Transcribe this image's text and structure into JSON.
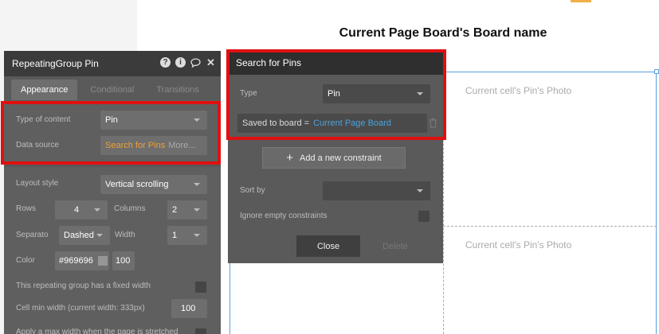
{
  "canvas": {
    "page_title": "Current Page Board's Board name",
    "cell_photo_1": "Current cell's Pin's Photo",
    "cell_photo_2": "Current cell's Pin's Photo"
  },
  "property_editor": {
    "title": "RepeatingGroup Pin",
    "header_icons": [
      "help-icon",
      "info-icon",
      "comment-icon",
      "close-icon"
    ],
    "tabs": [
      "Appearance",
      "Conditional",
      "Transitions"
    ],
    "active_tab": "Appearance",
    "type_of_content": {
      "label": "Type of content",
      "value": "Pin"
    },
    "data_source": {
      "label": "Data source",
      "value": "Search for Pins",
      "more": "More..."
    },
    "layout_style": {
      "label": "Layout style",
      "value": "Vertical scrolling"
    },
    "rows": {
      "label": "Rows",
      "value": "4"
    },
    "columns": {
      "label": "Columns",
      "value": "2"
    },
    "separator": {
      "label": "Separato",
      "value": "Dashed"
    },
    "width": {
      "label": "Width",
      "value": "1"
    },
    "color": {
      "label": "Color",
      "hex": "#969696",
      "opacity": "100"
    },
    "fixed_width": {
      "label": "This repeating group has a fixed width"
    },
    "cell_min_width": {
      "label": "Cell min width (current width: 333px)",
      "value": "100"
    },
    "max_width": {
      "label": "Apply a max width when the page is stretched"
    }
  },
  "search_popup": {
    "title": "Search for Pins",
    "type": {
      "label": "Type",
      "value": "Pin"
    },
    "constraint": {
      "field": "Saved to board =",
      "value": "Current Page Board"
    },
    "add_constraint": "Add a new constraint",
    "sort_by": {
      "label": "Sort by",
      "value": ""
    },
    "ignore_empty": {
      "label": "Ignore empty constraints"
    },
    "close_label": "Close",
    "delete_label": "Delete"
  },
  "colors": {
    "highlight": "#e01010",
    "link": "#4aa3df",
    "source": "#f0a030",
    "selection": "#5aa0e0"
  }
}
